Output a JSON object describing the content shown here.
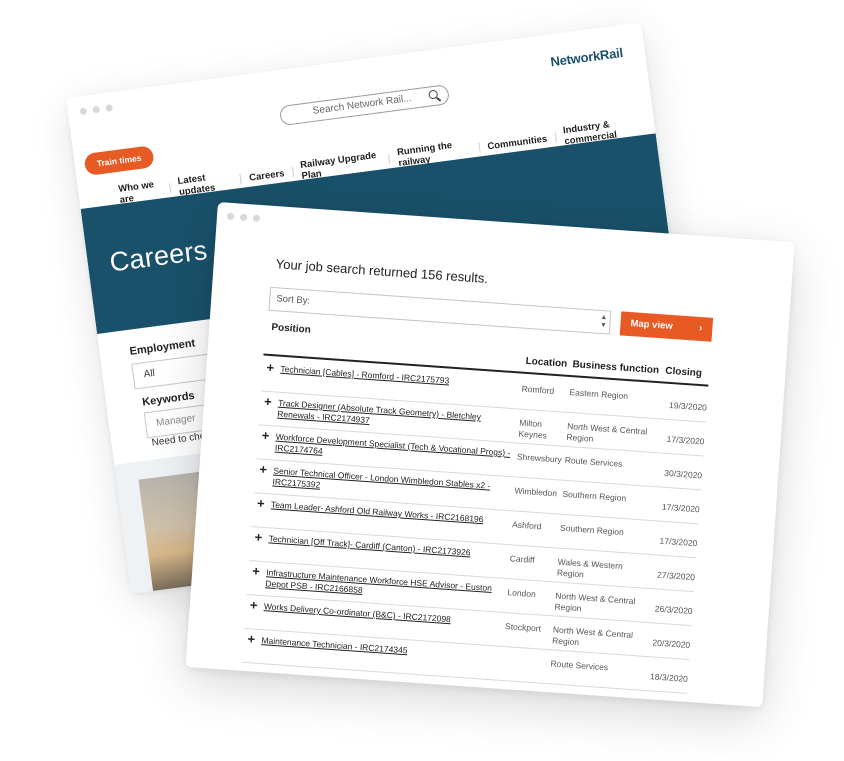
{
  "back_window": {
    "logo": "NetworkRail",
    "search_placeholder": "Search Network Rail...",
    "train_times_label": "Train times",
    "nav": [
      "Who we are",
      "Latest updates",
      "Careers",
      "Railway Upgrade Plan",
      "Running the railway",
      "Communities",
      "Industry & commercial"
    ],
    "hero_title": "Careers",
    "employment_label": "Employment",
    "employment_value": "All",
    "keywords_label": "Keywords",
    "keywords_placeholder": "Manager",
    "note": "Need to check an ex"
  },
  "front_window": {
    "results_title": "Your job search returned 156 results.",
    "sort_label": "Sort By:",
    "map_button_label": "Map view",
    "map_button_icon": "›",
    "columns": {
      "position": "Position",
      "location": "Location",
      "business_function": "Business function",
      "closing": "Closing"
    },
    "rows": [
      {
        "position": "Technician [Cables] - Romford - IRC2175793",
        "location": "Romford",
        "business": "Eastern Region",
        "closing": "19/3/2020"
      },
      {
        "position": "Track Designer (Absolute Track Geometry) - Bletchley Renewals - IRC2174937",
        "location": "Milton Keynes",
        "business": "North West & Central Region",
        "closing": "17/3/2020"
      },
      {
        "position": "Workforce Development Specialist (Tech & Vocational Progs) - IRC2174764",
        "location": "Shrewsbury",
        "business": "Route Services",
        "closing": "30/3/2020"
      },
      {
        "position": "Senior Technical Officer - London Wimbledon Stables x2 - IRC2175392",
        "location": "Wimbledon",
        "business": "Southern Region",
        "closing": "17/3/2020"
      },
      {
        "position": "Team Leader- Ashford Old Railway Works - IRC2168196",
        "location": "Ashford",
        "business": "Southern Region",
        "closing": "17/3/2020"
      },
      {
        "position": "Technician [Off Track]- Cardiff (Canton) - IRC2173926",
        "location": "Cardiff",
        "business": "Wales & Western Region",
        "closing": "27/3/2020"
      },
      {
        "position": "Infrastructure Maintenance Workforce HSE Advisor - Euston Depot PSB - IRC2166858",
        "location": "London",
        "business": "North West & Central Region",
        "closing": "26/3/2020"
      },
      {
        "position": "Works Delivery Co-ordinator (B&C) - IRC2172098",
        "location": "Stockport",
        "business": "North West & Central Region",
        "closing": "20/3/2020"
      },
      {
        "position": "Maintenance Technician - IRC2174345",
        "location": "",
        "business": "Route Services",
        "closing": "18/3/2020"
      }
    ]
  }
}
